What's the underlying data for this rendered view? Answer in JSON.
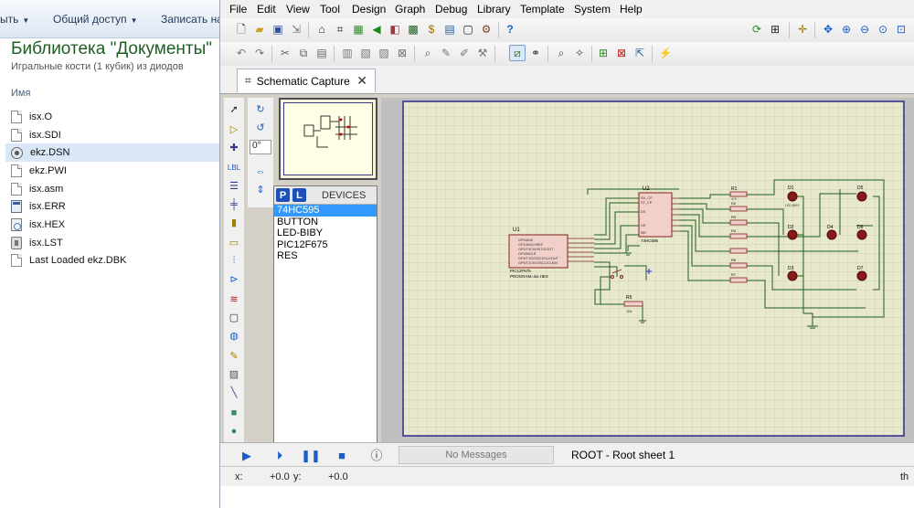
{
  "explorer": {
    "toolbar": {
      "item1": "ыть",
      "item2": "Общий доступ",
      "item3": "Записать на"
    },
    "library_title": "Библиотека \"Документы\"",
    "library_subtitle": "Игральные кости (1 кубик) из диодов",
    "column_name": "Имя",
    "files": [
      {
        "name": "isx.O",
        "icon": "document-icon"
      },
      {
        "name": "isx.SDI",
        "icon": "document-icon"
      },
      {
        "name": "ekz.DSN",
        "icon": "proteus-design-icon"
      },
      {
        "name": "ekz.PWI",
        "icon": "document-icon"
      },
      {
        "name": "isx.asm",
        "icon": "document-icon"
      },
      {
        "name": "isx.ERR",
        "icon": "error-file-icon"
      },
      {
        "name": "isx.HEX",
        "icon": "hex-file-icon"
      },
      {
        "name": "isx.LST",
        "icon": "list-file-icon"
      },
      {
        "name": "Last Loaded ekz.DBK",
        "icon": "document-icon"
      }
    ],
    "selected_file": "ekz.DSN"
  },
  "proteus": {
    "menu": [
      "File",
      "Edit",
      "View",
      "Tool",
      "Design",
      "Graph",
      "Debug",
      "Library",
      "Template",
      "System",
      "Help"
    ],
    "tab_label": "Schematic Capture",
    "rotation_value": "0°",
    "devices": {
      "picker_p": "P",
      "picker_l": "L",
      "title": "DEVICES",
      "items": [
        "74HC595",
        "BUTTON",
        "LED-BIBY",
        "PIC12F675",
        "RES"
      ],
      "selected": "74HC595"
    },
    "messages": "No Messages",
    "root_sheet": "ROOT - Root sheet 1",
    "coords": {
      "x_label": "x:",
      "x_value": "+0.0",
      "y_label": "y:",
      "y_value": "+0.0"
    },
    "bottom_text": "th",
    "schematic": {
      "u1_ref": "U1",
      "u1_part": "PIC12F675",
      "u1_program": "PROGRAM=isx.HEX",
      "u2_ref": "U2",
      "u2_part": "74HC595",
      "r5_ref": "R5",
      "r5_value": "10k",
      "resistors": [
        "R1",
        "R2",
        "R3",
        "R4",
        "R5",
        "R6",
        "R7"
      ],
      "resistor_value": "470",
      "leds": [
        "D1",
        "D2",
        "D3",
        "D4",
        "D5",
        "D6",
        "D7"
      ],
      "led_type": "LED-BIBY",
      "u2_pins": [
        "SH_CP",
        "ST_CP",
        "DS",
        "OE",
        "MR"
      ],
      "u1_pins": [
        "GP0/AN0",
        "GP1/AN1/VREF",
        "GP2/T0CKI/INT/COUT",
        "GP3/MCLR",
        "GP4/T1G/OSC2/CLKOUT",
        "GP5/T1CKI/OSC1/CLKIN"
      ]
    }
  }
}
